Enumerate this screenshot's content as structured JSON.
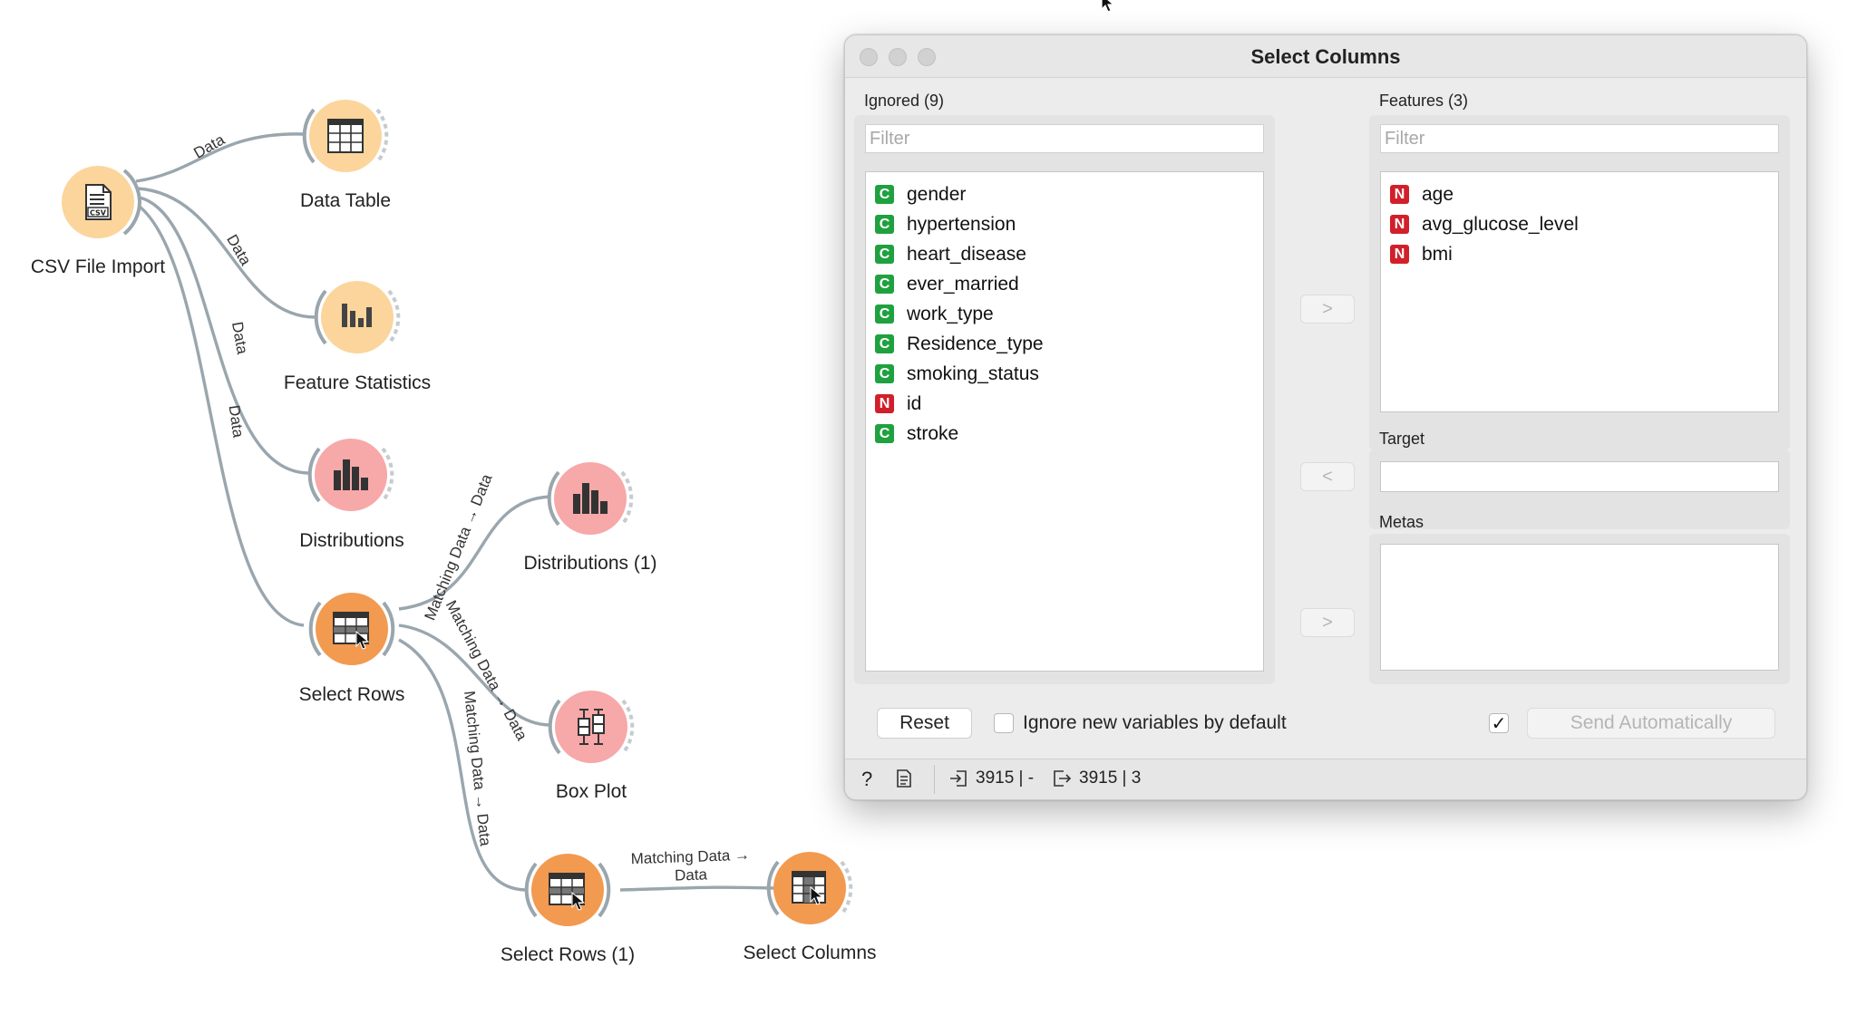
{
  "canvas": {
    "nodes": {
      "csv": {
        "label": "CSV File Import"
      },
      "data_table": {
        "label": "Data Table"
      },
      "feature_statistics": {
        "label": "Feature Statistics"
      },
      "distributions": {
        "label": "Distributions"
      },
      "select_rows": {
        "label": "Select Rows"
      },
      "distributions_1": {
        "label": "Distributions (1)"
      },
      "box_plot": {
        "label": "Box Plot"
      },
      "select_rows_1": {
        "label": "Select Rows (1)"
      },
      "select_columns": {
        "label": "Select Columns"
      }
    },
    "links": {
      "csv_table": "Data",
      "csv_stats": "Data",
      "csv_dist": "Data",
      "csv_rows": "Data",
      "rows_dist1": "Matching Data → Data",
      "rows_box": "Matching Data → Data",
      "rows_rows1": "Matching Data → Data",
      "rows1_cols_line1": "Matching Data →",
      "rows1_cols_line2": "Data"
    },
    "colors": {
      "data_node": "#fbd59c",
      "visualize_node": "#f7a8a8",
      "transform_node": "#f29a50",
      "link": "#9aa6ad"
    }
  },
  "dialog": {
    "title": "Select Columns",
    "ignored": {
      "label": "Ignored (9)",
      "filter_placeholder": "Filter",
      "items": [
        {
          "type": "C",
          "name": "gender"
        },
        {
          "type": "C",
          "name": "hypertension"
        },
        {
          "type": "C",
          "name": "heart_disease"
        },
        {
          "type": "C",
          "name": "ever_married"
        },
        {
          "type": "C",
          "name": "work_type"
        },
        {
          "type": "C",
          "name": "Residence_type"
        },
        {
          "type": "C",
          "name": "smoking_status"
        },
        {
          "type": "N",
          "name": "id"
        },
        {
          "type": "C",
          "name": "stroke"
        }
      ]
    },
    "features": {
      "label": "Features (3)",
      "filter_placeholder": "Filter",
      "items": [
        {
          "type": "N",
          "name": "age"
        },
        {
          "type": "N",
          "name": "avg_glucose_level"
        },
        {
          "type": "N",
          "name": "bmi"
        }
      ]
    },
    "target": {
      "label": "Target"
    },
    "metas": {
      "label": "Metas"
    },
    "move_buttons": {
      "to_features": ">",
      "from_target": "<",
      "to_metas": ">"
    },
    "reset_label": "Reset",
    "ignore_new_label": "Ignore new variables by default",
    "ignore_new_checked": false,
    "send_auto_checked": true,
    "send_auto_check_glyph": "✓",
    "send_auto_label": "Send Automatically",
    "status": {
      "help_glyph": "?",
      "input_summary": "3915 | -",
      "output_summary": "3915 | 3"
    },
    "colors": {
      "categorical": "#1fa13f",
      "numeric": "#d1202a"
    }
  }
}
